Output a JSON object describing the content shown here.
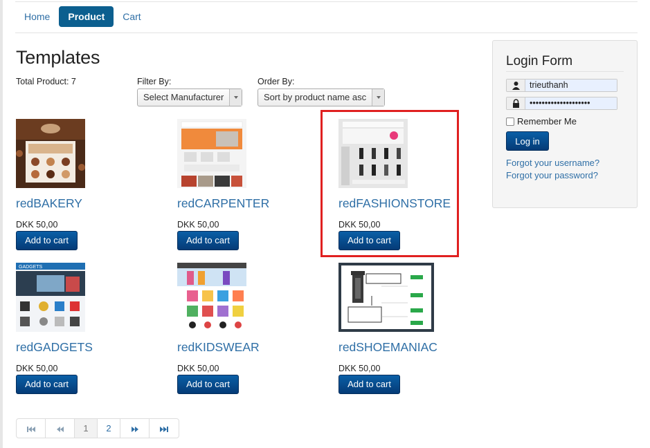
{
  "nav": {
    "items": [
      {
        "label": "Home",
        "active": false
      },
      {
        "label": "Product",
        "active": true
      },
      {
        "label": "Cart",
        "active": false
      }
    ]
  },
  "page": {
    "title": "Templates",
    "total_label": "Total Product: 7",
    "filter_label": "Filter By:",
    "filter_value": "Select Manufacturer",
    "order_label": "Order By:",
    "order_value": "Sort by product name asc"
  },
  "products": [
    {
      "name": "redBAKERY",
      "price": "DKK 50,00",
      "button": "Add to cart"
    },
    {
      "name": "redCARPENTER",
      "price": "DKK 50,00",
      "button": "Add to cart"
    },
    {
      "name": "redFASHIONSTORE",
      "price": "DKK 50,00",
      "button": "Add to cart",
      "highlighted": true
    },
    {
      "name": "redGADGETS",
      "price": "DKK 50,00",
      "button": "Add to cart"
    },
    {
      "name": "redKIDSWEAR",
      "price": "DKK 50,00",
      "button": "Add to cart"
    },
    {
      "name": "redSHOEMANIAC",
      "price": "DKK 50,00",
      "button": "Add to cart"
    }
  ],
  "pagination": {
    "pages": [
      "1",
      "2"
    ],
    "current": "1"
  },
  "login": {
    "title": "Login Form",
    "username": "trieuthanh",
    "password": "••••••••••••••••••••",
    "remember_label": "Remember Me",
    "button": "Log in",
    "forgot_username": "Forgot your username?",
    "forgot_password": "Forgot your password?"
  },
  "colors": {
    "accent": "#0c5f8f",
    "link": "#2f6fa6",
    "button": "#053b77",
    "highlight": "#e02020"
  }
}
